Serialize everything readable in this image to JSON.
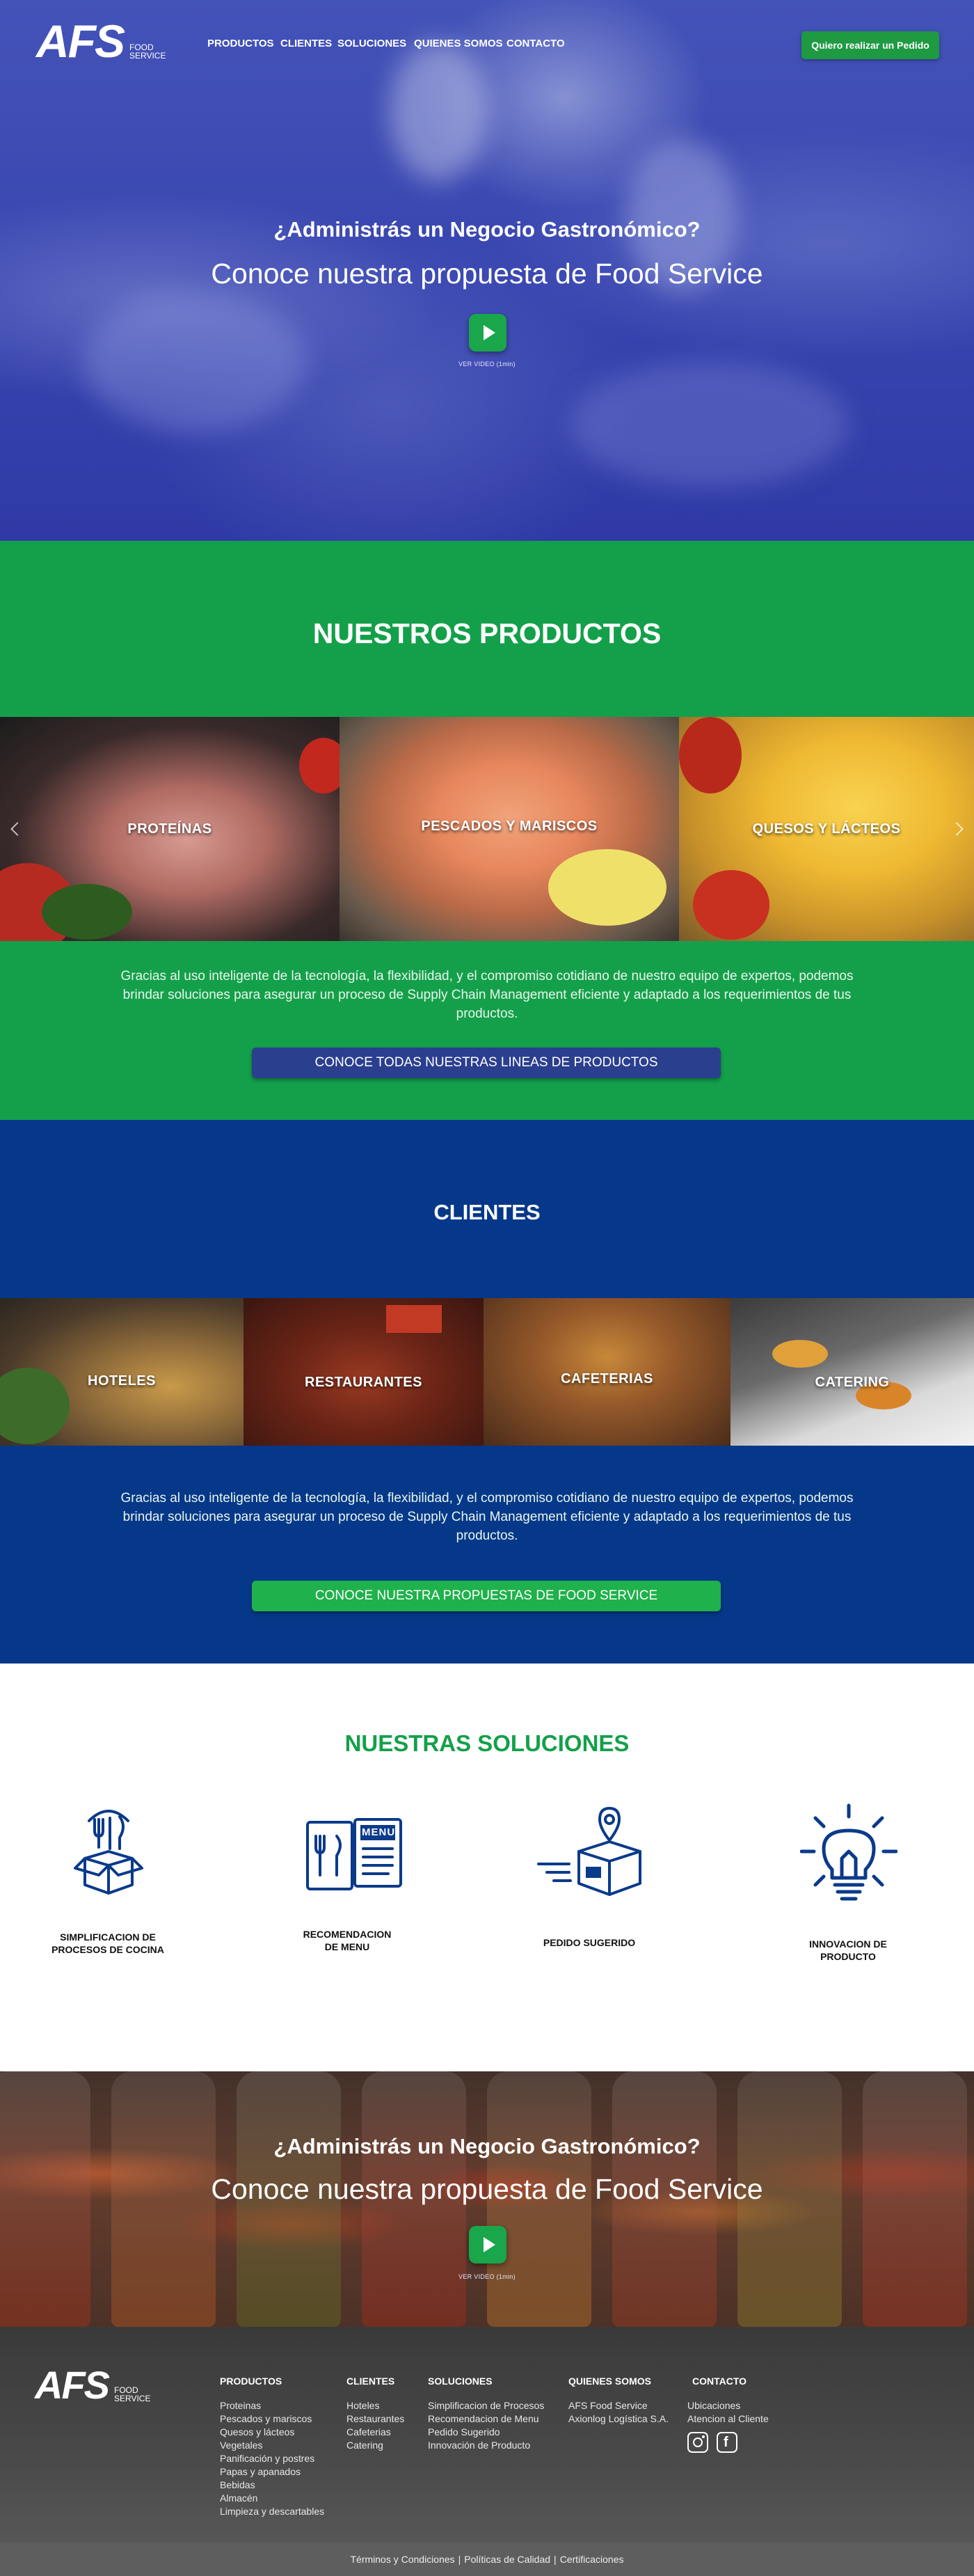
{
  "brand": {
    "logo_text": "AFS",
    "logo_sub_1": "FOOD",
    "logo_sub_2": "SERVICE"
  },
  "nav": {
    "items": [
      "PRODUCTOS",
      "CLIENTES",
      "SOLUCIONES",
      "QUIENES SOMOS",
      "CONTACTO"
    ],
    "order_button": "Quiero realizar un Pedido"
  },
  "hero": {
    "title": "¿Administrás un Negocio Gastronómico?",
    "subtitle": "Conoce nuestra propuesta de Food Service",
    "play_label": "VER VIDEO (1min)"
  },
  "productos": {
    "title": "NUESTROS PRODUCTOS",
    "tiles": [
      "PROTEÍNAS",
      "PESCADOS Y MARISCOS",
      "QUESOS Y LÁCTEOS"
    ],
    "description": "Gracias al uso inteligente de la tecnología, la flexibilidad, y el compromiso cotidiano de nuestro equipo de expertos, podemos brindar soluciones para asegurar un proceso de Supply Chain Management eficiente y adaptado a los requerimientos de tus productos.",
    "cta": "CONOCE TODAS NUESTRAS LINEAS DE PRODUCTOS"
  },
  "clientes": {
    "title": "CLIENTES",
    "tiles": [
      "HOTELES",
      "RESTAURANTES",
      "CAFETERIAS",
      "CATERING"
    ],
    "description": "Gracias al uso inteligente de la tecnología, la flexibilidad, y el compromiso cotidiano de nuestro equipo de expertos, podemos brindar soluciones para asegurar un proceso de Supply Chain Management eficiente y adaptado a los requerimientos de tus productos.",
    "cta": "CONOCE NUESTRA PROPUESTAS DE FOOD SERVICE"
  },
  "soluciones": {
    "title": "NUESTRAS SOLUCIONES",
    "items": [
      {
        "line1": "SIMPLIFICACION DE",
        "line2": "PROCESOS DE COCINA",
        "icon": "kitchen-box-icon"
      },
      {
        "line1": "RECOMENDACION",
        "line2": "DE MENU",
        "icon": "menu-book-icon"
      },
      {
        "line1": "PEDIDO SUGERIDO",
        "line2": "",
        "icon": "delivery-box-icon"
      },
      {
        "line1": "INNOVACION DE",
        "line2": "PRODUCTO",
        "icon": "lightbulb-icon"
      }
    ],
    "menu_word": "MENU"
  },
  "cta2": {
    "title": "¿Administrás un Negocio Gastronómico?",
    "subtitle": "Conoce nuestra propuesta de Food Service",
    "play_label": "VER VIDEO (1min)"
  },
  "footer": {
    "columns": [
      {
        "head": "PRODUCTOS",
        "items": [
          "Proteinas",
          "Pescados y mariscos",
          "Quesos y lácteos",
          "Vegetales",
          "Panificación y postres",
          "Papas y apanados",
          "Bebidas",
          "Almacén",
          "Limpieza y descartables"
        ]
      },
      {
        "head": "CLIENTES",
        "items": [
          "Hoteles",
          "Restaurantes",
          "Cafeterias",
          "Catering"
        ]
      },
      {
        "head": "SOLUCIONES",
        "items": [
          "Simplificacion de Procesos",
          "Recomendacion de Menu",
          "Pedido Sugerido",
          "Innovación de Producto"
        ]
      },
      {
        "head": "QUIENES SOMOS",
        "items": [
          "AFS Food Service",
          "Axionlog Logística S.A."
        ]
      },
      {
        "head": "CONTACTO",
        "items": [
          "Ubicaciones",
          "Atencion al Cliente"
        ]
      }
    ],
    "social": [
      "instagram-icon",
      "facebook-icon"
    ],
    "bottom_links": [
      "Términos y Condiciones",
      "Políticas de Calidad",
      "Certificaciones"
    ],
    "separator": "|"
  },
  "colors": {
    "green": "#14a04a",
    "blue": "#053889",
    "hero_blue": "#3a47b1",
    "button_green": "#1f9a43",
    "button_blue": "#2b3f8f"
  }
}
